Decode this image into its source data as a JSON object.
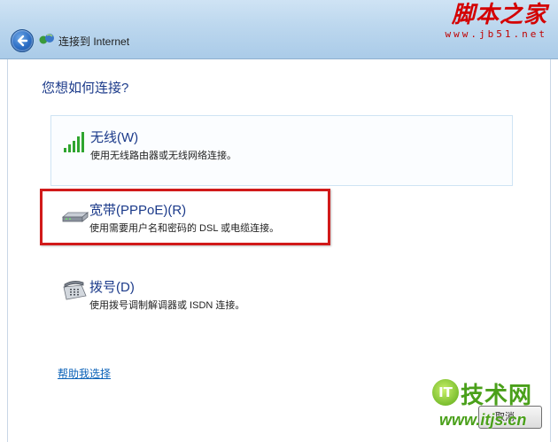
{
  "window": {
    "title": "连接到 Internet"
  },
  "watermark_top": {
    "name": "脚本之家",
    "url": "www.jb51.net"
  },
  "main": {
    "question": "您想如何连接?",
    "options": [
      {
        "title": "无线(W)",
        "desc": "使用无线路由器或无线网络连接。",
        "icon": "wireless-signal-icon"
      },
      {
        "title": "宽带(PPPoE)(R)",
        "desc": "使用需要用户名和密码的 DSL 或电缆连接。",
        "icon": "broadband-modem-icon"
      },
      {
        "title": "拨号(D)",
        "desc": "使用拨号调制解调器或 ISDN 连接。",
        "icon": "dialup-phone-icon"
      }
    ],
    "help_link": "帮助我选择"
  },
  "footer": {
    "cancel_label": "取消"
  },
  "watermark_bottom": {
    "logo_mark": "IT",
    "logo_text": "技术网",
    "url": "www.itjs.cn"
  },
  "colors": {
    "accent": "#1b3a8a",
    "highlight": "#d11a1a",
    "link": "#0b62b8",
    "titlebar": "#bcd7ee"
  }
}
